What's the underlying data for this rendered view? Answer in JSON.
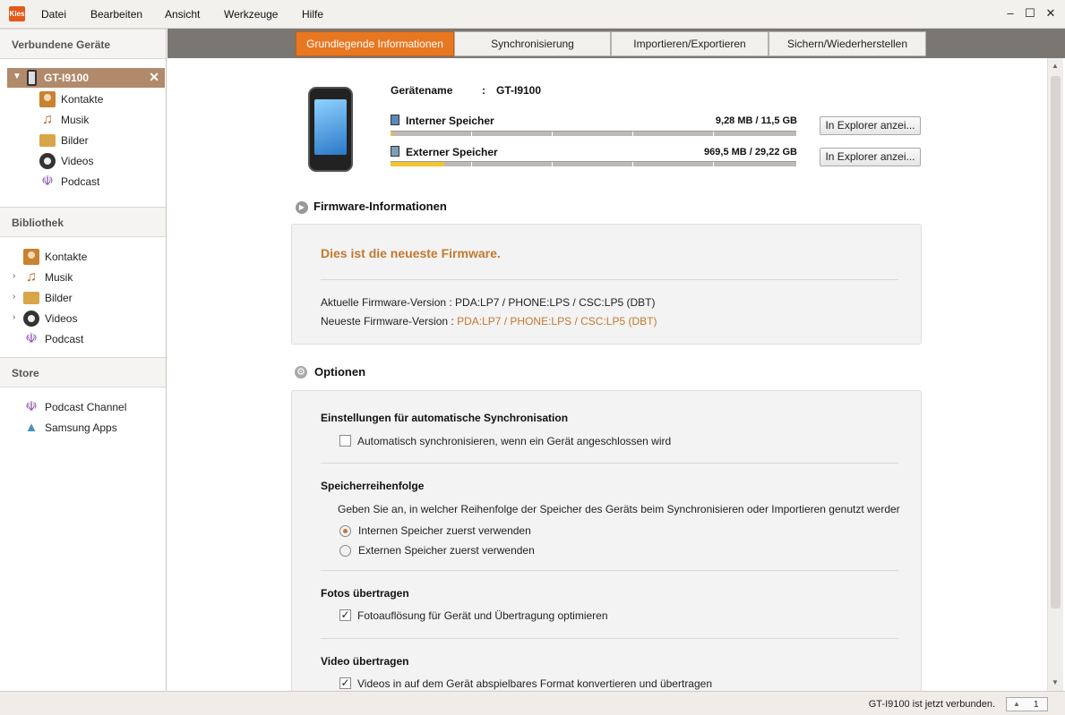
{
  "menubar": {
    "app_icon": "Kies",
    "items": [
      "Datei",
      "Bearbeiten",
      "Ansicht",
      "Werkzeuge",
      "Hilfe"
    ],
    "window_buttons": [
      "–",
      "☐",
      "✕"
    ]
  },
  "sidebar": {
    "connected_header": "Verbundene Geräte",
    "device": {
      "name": "GT-I9100",
      "close": "✕"
    },
    "device_items": [
      "Kontakte",
      "Musik",
      "Bilder",
      "Videos",
      "Podcast"
    ],
    "library_header": "Bibliothek",
    "library_items": [
      "Kontakte",
      "Musik",
      "Bilder",
      "Videos",
      "Podcast"
    ],
    "store_header": "Store",
    "store_items": [
      "Podcast Channel",
      "Samsung Apps"
    ]
  },
  "tabs": [
    "Grundlegende Informationen",
    "Synchronisierung",
    "Importieren/Exportieren",
    "Sichern/Wiederherstellen"
  ],
  "device_info": {
    "name_label": "Gerätename",
    "name_sep": ":",
    "name_value": "GT-I9100",
    "internal_label": "Interner Speicher",
    "internal_value": "9,28 MB / 11,5 GB",
    "internal_used_fraction": 0.001,
    "external_label": "Externer Speicher",
    "external_value": "969,5 MB / 29,22 GB",
    "external_used_fraction": 0.033,
    "explorer_button": "In Explorer anzei..."
  },
  "firmware": {
    "title": "Firmware-Informationen",
    "status": "Dies ist die neueste Firmware.",
    "current_label": "Aktuelle Firmware-Version : ",
    "current_value": "PDA:LP7 / PHONE:LPS / CSC:LP5 (DBT)",
    "latest_label": "Neueste Firmware-Version : ",
    "latest_value": "PDA:LP7 / PHONE:LPS / CSC:LP5 (DBT)"
  },
  "options": {
    "title": "Optionen",
    "auto_sync_title": "Einstellungen für automatische Synchronisation",
    "auto_sync_label": "Automatisch synchronisieren, wenn ein Gerät angeschlossen wird",
    "storage_order_title": "Speicherreihenfolge",
    "storage_order_desc": "Geben Sie an, in welcher Reihenfolge der Speicher des Geräts beim Synchronisieren oder Importieren genutzt werder",
    "storage_internal": "Internen Speicher zuerst verwenden",
    "storage_external": "Externen Speicher zuerst verwenden",
    "photos_title": "Fotos übertragen",
    "photos_label": "Fotoauflösung für Gerät und Übertragung optimieren",
    "video_title": "Video übertragen",
    "video_label": "Videos in auf dem Gerät abspielbares Format konvertieren und übertragen"
  },
  "statusbar": {
    "text": "GT-I9100 ist jetzt verbunden.",
    "page": "1"
  }
}
